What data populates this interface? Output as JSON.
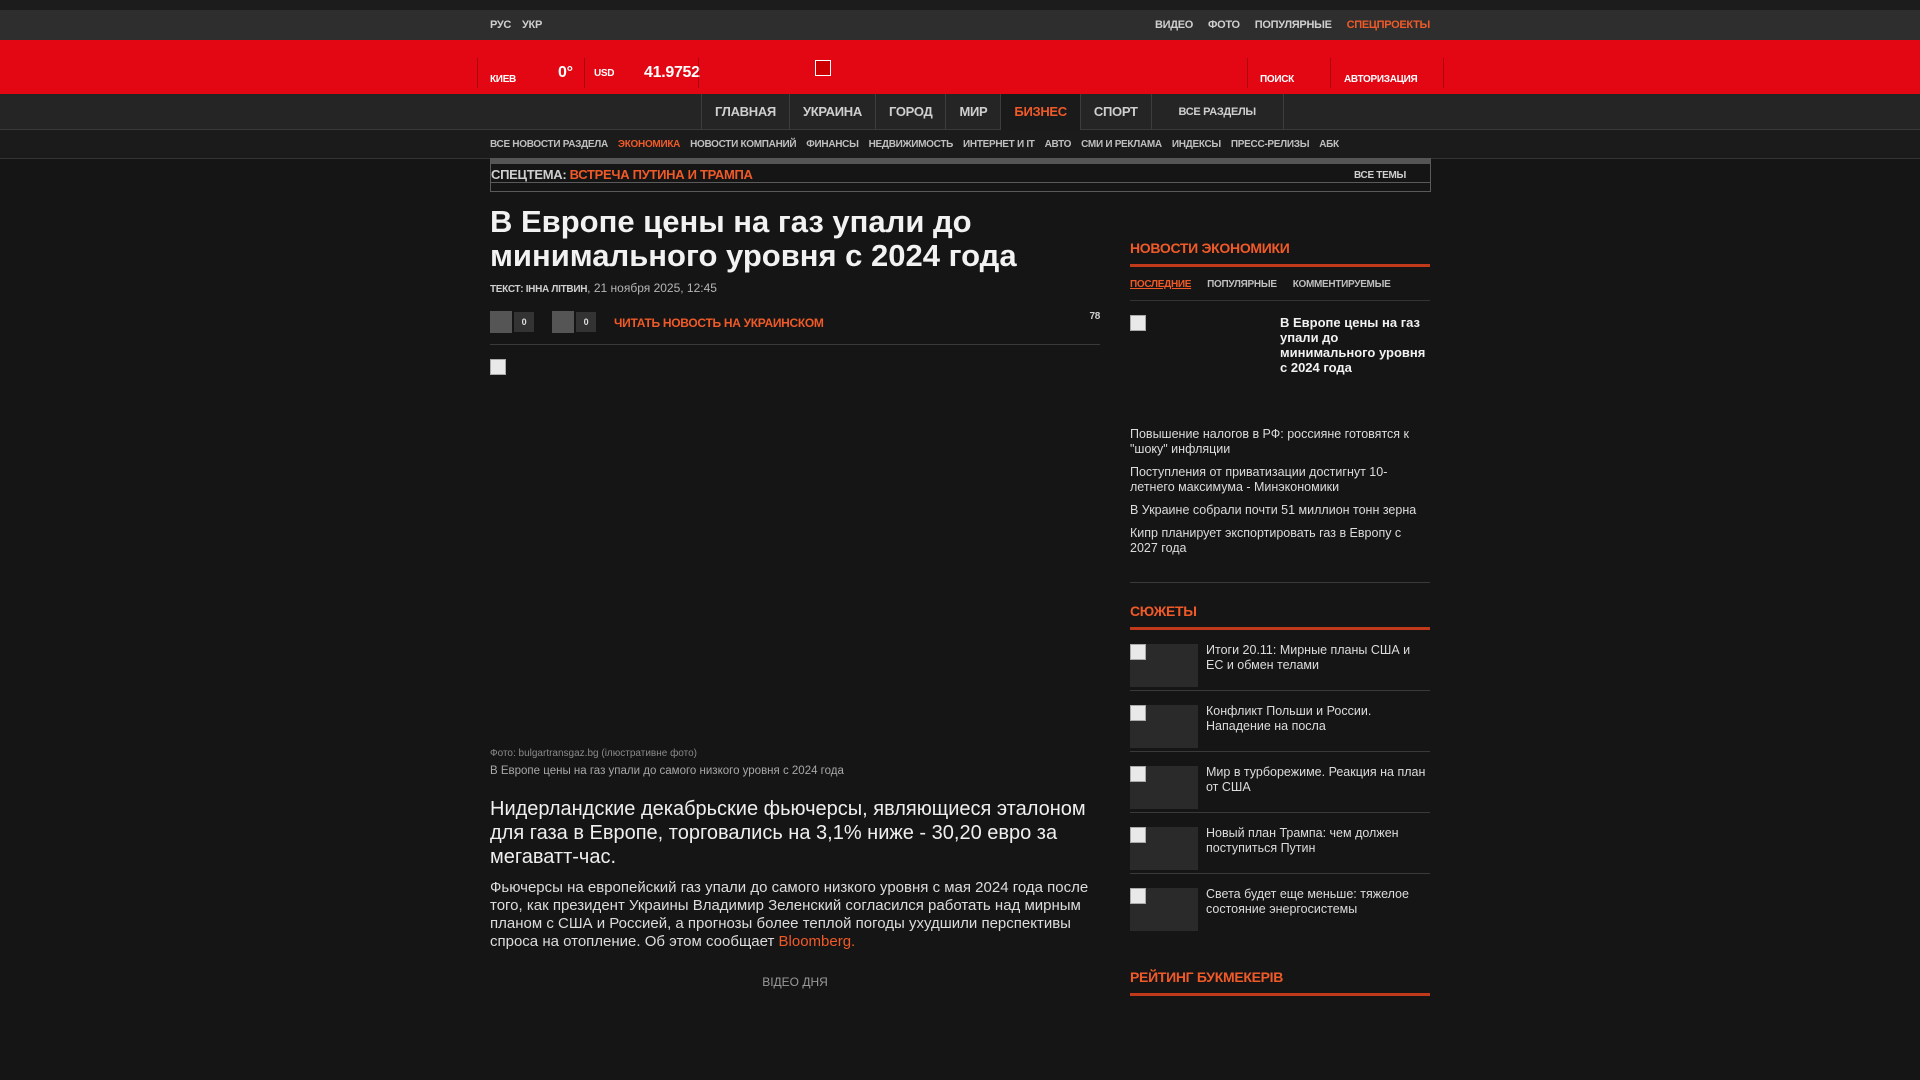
{
  "topbar": {
    "lang_ru": "РУС",
    "lang_ua": "УКР",
    "links": [
      "ВИДЕО",
      "ФОТО",
      "ПОПУЛЯРНЫЕ",
      "СПЕЦПРОЕКТЫ"
    ]
  },
  "header": {
    "city": "КИЕВ",
    "temp": "0°",
    "currency": "USD",
    "rate": "41.9752",
    "search": "ПОИСК",
    "login": "АВТОРИЗАЦИЯ"
  },
  "mainnav": {
    "items": [
      "ГЛАВНАЯ",
      "УКРАИНА",
      "ГОРОД",
      "МИР",
      "БИЗНЕС",
      "СПОРТ"
    ],
    "active": "БИЗНЕС",
    "all": "ВСЕ РАЗДЕЛЫ"
  },
  "subnav": {
    "items": [
      "ВСЕ НОВОСТИ РАЗДЕЛА",
      "ЭКОНОМИКА",
      "НОВОСТИ КОМПАНИЙ",
      "ФИНАНСЫ",
      "НЕДВИЖИМОСТЬ",
      "ИНТЕРНЕТ И IT",
      "АВТО",
      "СМИ И РЕКЛАМА",
      "ИНДЕКСЫ",
      "ПРЕСС-РЕЛИЗЫ",
      "АБК"
    ],
    "active": "ЭКОНОМИКА"
  },
  "spectheme": {
    "label": "СПЕЦТЕМА:",
    "topic": "ВСТРЕЧА ПУТИНА И ТРАМПА",
    "all": "ВСЕ ТЕМЫ"
  },
  "article": {
    "title": "В Европе цены на газ упали до минимального уровня с 2024 года",
    "author": "ТЕКСТ: ІННА ЛІТВИН",
    "date": "21 ноября 2025, 12:45",
    "share_count_1": "0",
    "share_count_2": "0",
    "read_ua": "ЧИТАТЬ НОВОСТЬ НА УКРАИНСКОМ",
    "views": "78",
    "photo_credit": "Фото: bulgartransgaz.bg (ілюстративне фото)",
    "photo_caption": "В Европе цены на газ упали до самого низкого уровня с 2024 года",
    "lead": "Нидерландские декабрьские фьючерсы, являющиеся эталоном для газа в Европе, торговались на 3,1% ниже - 30,20 евро за мегаватт-час.",
    "body": "Фьючерсы на европейский газ упали до самого низкого уровня с мая 2024 года после того, как президент Украины Владимир Зеленский согласился работать над мирным планом с США и Россией, а прогнозы более теплой погоды ухудшили перспективы спроса на отопление. Об этом сообщает",
    "source": "Bloomberg.",
    "video_day": "ВІДЕО ДНЯ"
  },
  "sidebar": {
    "news_head": "НОВОСТИ ЭКОНОМИКИ",
    "tabs": [
      "ПОСЛЕДНИЕ",
      "ПОПУЛЯРНЫЕ",
      "КОММЕНТИРУЕМЫЕ"
    ],
    "featured": "В Европе цены на газ упали до минимального уровня с 2024 года",
    "news": [
      "Повышение налогов в РФ: россияне готовятся к \"шоку\" инфляции",
      "Поступления от приватизации достигнут 10-летнего максимума - Минэкономики",
      "В Украине собрали почти 51 миллион тонн зерна",
      "Кипр планирует экспортировать газ в Европу с 2027 года"
    ],
    "stories_head": "СЮЖЕТЫ",
    "stories": [
      "Итоги 20.11: Мирные планы США и ЕС и обмен телами",
      "Конфликт Польши и России. Нападение на посла",
      "Мир в турборежиме. Реакция на план от США",
      "Новый план Трампа: чем должен поступиться Путин",
      "Света будет еще меньше: тяжелое состояние энергосистемы"
    ],
    "bookmakers_head": "РЕЙТИНГ БУКМЕКЕРІВ"
  }
}
